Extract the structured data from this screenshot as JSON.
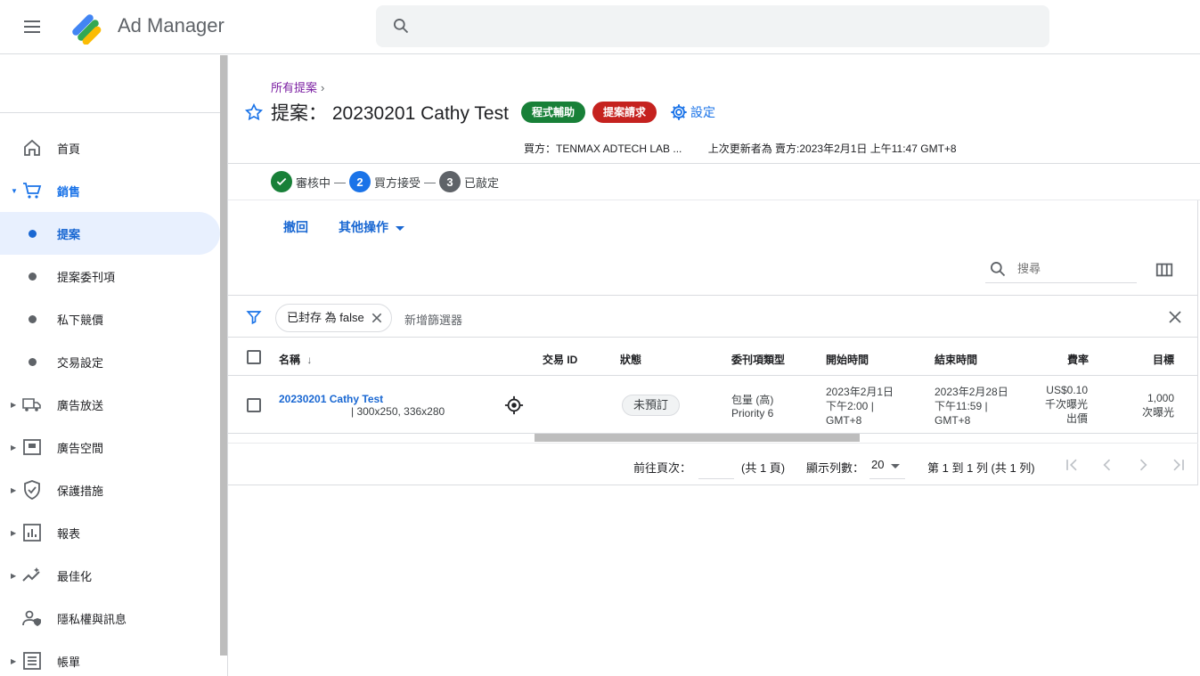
{
  "app": {
    "title": "Ad Manager",
    "search_placeholder": ""
  },
  "sidebar": {
    "items": [
      {
        "label": "首頁",
        "icon": "home-icon"
      },
      {
        "label": "銷售",
        "icon": "cart-icon"
      },
      {
        "label": "提案"
      },
      {
        "label": "提案委刊項"
      },
      {
        "label": "私下競價"
      },
      {
        "label": "交易設定"
      },
      {
        "label": "廣告放送",
        "icon": "truck-icon"
      },
      {
        "label": "廣告空間",
        "icon": "inventory-icon"
      },
      {
        "label": "保護措施",
        "icon": "shield-icon"
      },
      {
        "label": "報表",
        "icon": "report-icon"
      },
      {
        "label": "最佳化",
        "icon": "optimize-icon"
      },
      {
        "label": "隱私權與訊息",
        "icon": "privacy-icon"
      },
      {
        "label": "帳單",
        "icon": "billing-icon"
      }
    ]
  },
  "page": {
    "breadcrumb": "所有提案",
    "title": "提案： 20230201 Cathy Test",
    "chips": {
      "programmatic": "程式輔助",
      "request": "提案請求"
    },
    "settings_label": "設定",
    "buyer": "買方：TENMAX ADTECH LAB ...",
    "last_updated": "上次更新者為 賣方:2023年2月1日 上午11:47 GMT+8",
    "steps": [
      {
        "num": "",
        "label": "審核中"
      },
      {
        "num": "2",
        "label": "買方接受"
      },
      {
        "num": "3",
        "label": "已敲定"
      }
    ],
    "step_sep": "—",
    "actions": {
      "retract": "撤回",
      "more": "其他操作"
    }
  },
  "table": {
    "search_placeholder": "搜尋",
    "filter_chip": "已封存 為 false",
    "add_filter": "新增篩選器",
    "headers": {
      "name": "名稱",
      "deal_id": "交易 ID",
      "status": "狀態",
      "type": "委刊項類型",
      "start": "開始時間",
      "end": "結束時間",
      "rate": "費率",
      "goal": "目標"
    },
    "rows": [
      {
        "name": "20230201 Cathy Test",
        "sizes": "| 300x250, 336x280",
        "deal_id": "",
        "status": "未預訂",
        "type_line1": "包量 (高)",
        "type_line2": "Priority 6",
        "start_line1": "2023年2月1日",
        "start_line2": "下午2:00 |",
        "start_line3": "GMT+8",
        "end_line1": "2023年2月28日",
        "end_line2": "下午11:59 |",
        "end_line3": "GMT+8",
        "rate_line1": "US$0.10",
        "rate_line2": "千次曝光",
        "rate_line3": "出價",
        "goal_line1": "1,000",
        "goal_line2": "次曝光"
      }
    ]
  },
  "pager": {
    "goto_label": "前往頁次：",
    "total_pages": "(共 1 頁)",
    "rows_label": "顯示列數：",
    "rows_value": "20",
    "range": "第 1 到 1 列 (共 1 列)"
  },
  "colors": {
    "accent": "#1a73e8",
    "green": "#188038",
    "red": "#c5221f"
  }
}
